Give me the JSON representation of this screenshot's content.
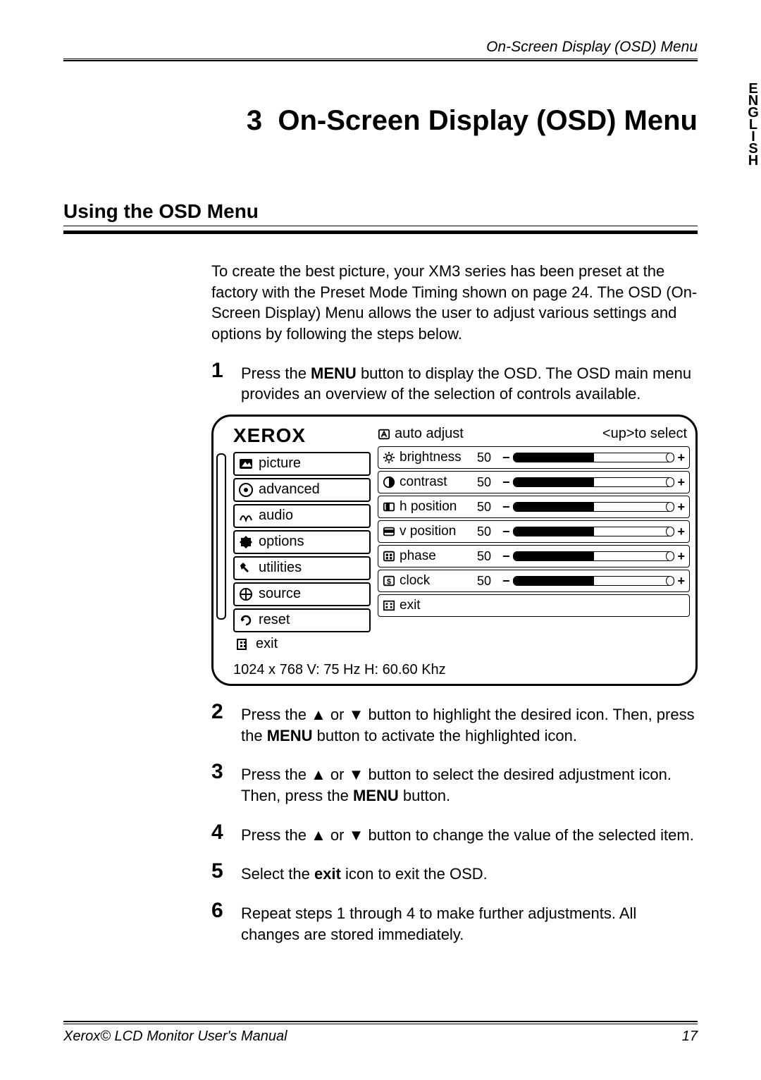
{
  "header": {
    "running_title": "On-Screen Display (OSD) Menu"
  },
  "side_tab": "ENGLISH",
  "chapter": {
    "number": "3",
    "title": "On-Screen Display (OSD) Menu"
  },
  "section_title": "Using the OSD Menu",
  "intro": "To create the best picture, your XM3 series has been preset at the factory with the Preset Mode Timing shown on page 24. The OSD (On-Screen Display) Menu allows the user to adjust various settings and options by following the steps below.",
  "steps": [
    {
      "num": "1",
      "pre": "Press the ",
      "bold": "MENU",
      "post": " button to display the OSD. The OSD main menu provides an overview of the selection of controls available."
    },
    {
      "num": "2",
      "pre": "Press the  ▲  or  ▼  button to highlight the desired icon.  Then, press the ",
      "bold": "MENU",
      "post": " button to activate the highlighted icon."
    },
    {
      "num": "3",
      "pre": "Press the  ▲  or  ▼  button to select the desired adjustment icon. Then, press the ",
      "bold": "MENU",
      "post": " button."
    },
    {
      "num": "4",
      "pre": "Press the  ▲  or  ▼  button to change the value of the selected item.",
      "bold": "",
      "post": ""
    },
    {
      "num": "5",
      "pre": "Select the ",
      "bold": "exit",
      "post": " icon to exit the OSD."
    },
    {
      "num": "6",
      "pre": "Repeat steps 1 through 4 to make further adjustments. All changes are stored immediately.",
      "bold": "",
      "post": ""
    }
  ],
  "osd": {
    "logo": "XEROX",
    "left_items": [
      {
        "icon": "picture",
        "label": "picture"
      },
      {
        "icon": "advanced",
        "label": "advanced"
      },
      {
        "icon": "audio",
        "label": "audio"
      },
      {
        "icon": "options",
        "label": "options"
      },
      {
        "icon": "utilities",
        "label": "utilities"
      },
      {
        "icon": "source",
        "label": "source"
      },
      {
        "icon": "reset",
        "label": "reset"
      },
      {
        "icon": "exit",
        "label": "exit"
      }
    ],
    "top_right_left": "auto adjust",
    "top_right_right": "<up>to select",
    "right_rows": [
      {
        "icon": "sun",
        "label": "brightness",
        "value": "50"
      },
      {
        "icon": "contrast",
        "label": "contrast",
        "value": "50"
      },
      {
        "icon": "hpos",
        "label": "h position",
        "value": "50"
      },
      {
        "icon": "vpos",
        "label": "v position",
        "value": "50"
      },
      {
        "icon": "phase",
        "label": "phase",
        "value": "50"
      },
      {
        "icon": "clock",
        "label": "clock",
        "value": "50"
      }
    ],
    "exit_label": "exit",
    "status": "1024 x 768 V: 75 Hz   H: 60.60 Khz"
  },
  "footer": {
    "left": "Xerox© LCD Monitor User's Manual",
    "right": "17"
  }
}
